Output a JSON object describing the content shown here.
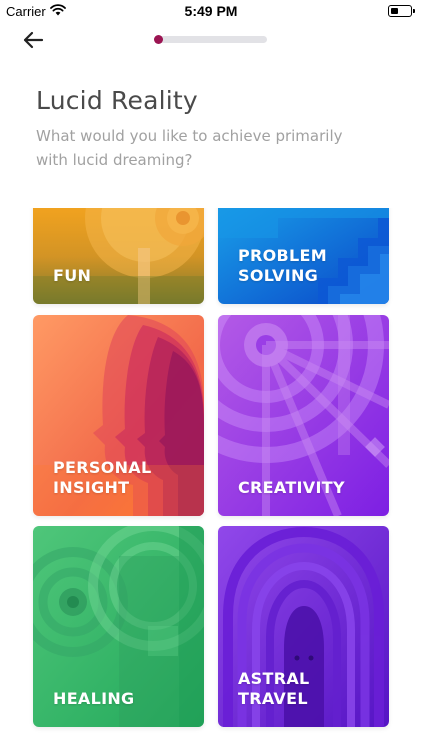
{
  "status_bar": {
    "carrier": "Carrier",
    "time": "5:49 PM",
    "battery_level": 0.35
  },
  "header": {
    "back_icon": "arrow-left-icon",
    "progress": 0.05,
    "accent_color": "#9b1452"
  },
  "page": {
    "title": "Lucid Reality",
    "subtitle": "What would you like to achieve primarily with lucid dreaming?"
  },
  "goals": [
    {
      "label": "FUN",
      "colors": [
        "#f6a21c",
        "#8a7a2a"
      ]
    },
    {
      "label": "PROBLEM\nSOLVING",
      "colors": [
        "#1a8fe6",
        "#0b4fc9"
      ]
    },
    {
      "label": "PERSONAL\nINSIGHT",
      "colors": [
        "#ff8a5b",
        "#c2185b"
      ]
    },
    {
      "label": "CREATIVITY",
      "colors": [
        "#b25ae8",
        "#7b1fe0"
      ]
    },
    {
      "label": "HEALING",
      "colors": [
        "#4cc77a",
        "#1f9e57"
      ]
    },
    {
      "label": "ASTRAL\nTRAVEL",
      "colors": [
        "#8e44e8",
        "#5a16c7"
      ]
    }
  ]
}
